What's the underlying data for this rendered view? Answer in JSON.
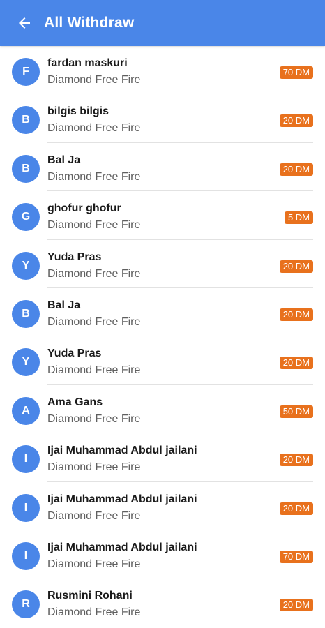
{
  "appbar": {
    "title": "All Withdraw",
    "back_icon": "arrow-back-icon",
    "color": "#4a86e8"
  },
  "accent_colors": {
    "avatar": "#4a86e8",
    "amount_badge": "#e8711d"
  },
  "withdrawals": [
    {
      "initial": "F",
      "name": "fardan maskuri",
      "item": "Diamond Free Fire",
      "amount": "70 DM"
    },
    {
      "initial": "B",
      "name": "bilgis bilgis",
      "item": "Diamond Free Fire",
      "amount": "20 DM"
    },
    {
      "initial": "B",
      "name": "Bal Ja",
      "item": "Diamond Free Fire",
      "amount": "20 DM"
    },
    {
      "initial": "G",
      "name": "ghofur ghofur",
      "item": "Diamond Free Fire",
      "amount": "5 DM"
    },
    {
      "initial": "Y",
      "name": "Yuda Pras",
      "item": "Diamond Free Fire",
      "amount": "20 DM"
    },
    {
      "initial": "B",
      "name": "Bal Ja",
      "item": "Diamond Free Fire",
      "amount": "20 DM"
    },
    {
      "initial": "Y",
      "name": "Yuda Pras",
      "item": "Diamond Free Fire",
      "amount": "20 DM"
    },
    {
      "initial": "A",
      "name": "Ama Gans",
      "item": "Diamond Free Fire",
      "amount": "50 DM"
    },
    {
      "initial": "I",
      "name": "Ijai Muhammad Abdul jailani",
      "item": "Diamond Free Fire",
      "amount": "20 DM"
    },
    {
      "initial": "I",
      "name": "Ijai Muhammad Abdul jailani",
      "item": "Diamond Free Fire",
      "amount": "20 DM"
    },
    {
      "initial": "I",
      "name": "Ijai Muhammad Abdul jailani",
      "item": "Diamond Free Fire",
      "amount": "70 DM"
    },
    {
      "initial": "R",
      "name": "Rusmini Rohani",
      "item": "Diamond Free Fire",
      "amount": "20 DM"
    }
  ]
}
